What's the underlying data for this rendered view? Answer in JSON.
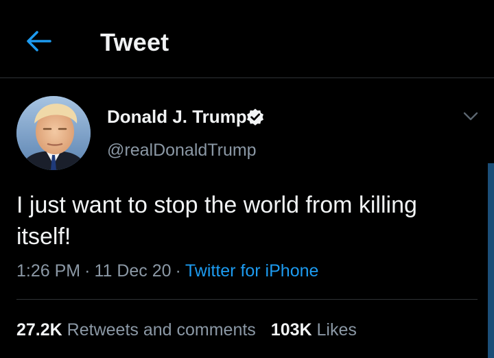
{
  "header": {
    "title": "Tweet",
    "back_icon": "arrow-left-icon",
    "accent_color": "#1d9bf0"
  },
  "tweet": {
    "author": {
      "display_name": "Donald J. Trump",
      "handle": "@realDonaldTrump",
      "verified": true,
      "verified_icon": "verified-badge-icon"
    },
    "text": "I just want to stop the world from killing itself!",
    "time": "1:26 PM",
    "date": "11 Dec 20",
    "separator": "·",
    "source": "Twitter for iPhone",
    "more_icon": "chevron-down-icon"
  },
  "stats": {
    "retweets_count": "27.2K",
    "retweets_label": "Retweets and comments",
    "likes_count": "103K",
    "likes_label": "Likes"
  },
  "colors": {
    "background": "#000000",
    "primary_text": "#e7e9ea",
    "secondary_text": "#8b98a5",
    "link": "#1d9bf0",
    "divider": "#2f3336"
  }
}
